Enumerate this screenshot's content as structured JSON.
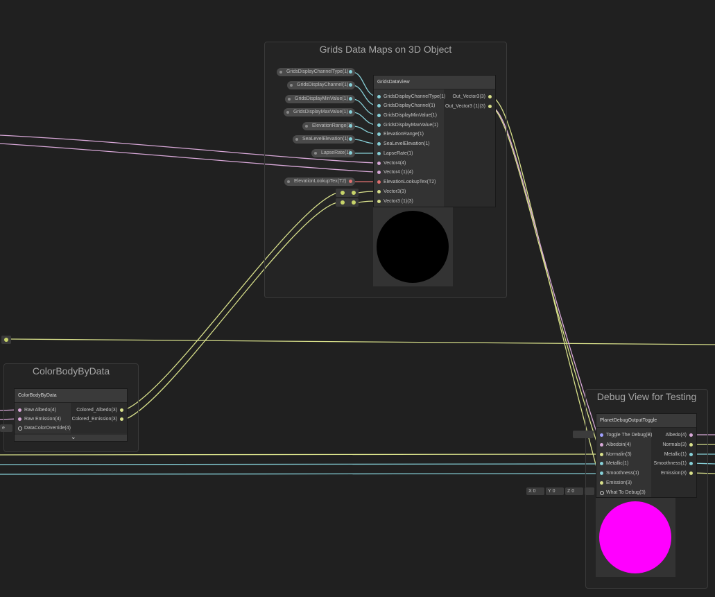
{
  "colors": {
    "background": "#202020",
    "vector4": "#d8a8d8",
    "vector3": "#d8e08a",
    "vector1": "#86d0d8",
    "texture": "#e07070",
    "bool": "#a0a0ff",
    "magenta_preview": "#ff00ff",
    "black_preview": "#000000"
  },
  "groups": {
    "grids": {
      "title": "Grids Data Maps on 3D Object"
    },
    "colorbody": {
      "title": "ColorBodyByData"
    },
    "debug": {
      "title": "Debug View for Testing"
    }
  },
  "grids_node": {
    "title": "GridsDataView",
    "inputs": [
      "GridsDisplayChannelType(1)",
      "GridsDisplayChannel(1)",
      "GridsDisplayMinValue(1)",
      "GridsDisplayMaxValue(1)",
      "ElevationRange(1)",
      "SeaLevelElevation(1)",
      "LapseRate(1)",
      "Vector4(4)",
      "Vector4 (1)(4)",
      "ElevationLookupTex(T2)",
      "Vector3(3)",
      "Vector3 (1)(3)"
    ],
    "outputs": [
      "Out_Vector3(3)",
      "Out_Vector3 (1)(3)"
    ]
  },
  "property_pills": [
    "GridsDisplayChannelType(1)",
    "GridsDisplayChannel(1)",
    "GridsDisplayMinValue(1)",
    "GridsDisplayMaxValue(1)",
    "ElevationRange(1)",
    "SeaLevelElevation(1)",
    "LapseRate(1)",
    "ElevationLookupTex(T2)"
  ],
  "colorbody_node": {
    "title": "ColorBodyByData",
    "inputs": [
      "Raw Albedo(4)",
      "Raw Emission(4)",
      "DataColorOverride(4)"
    ],
    "outputs": [
      "Colored_Albedo(3)",
      "Colored_Emission(3)"
    ],
    "partial_label": "e"
  },
  "debug_node": {
    "title": "PlanetDebugOutputToggle",
    "inputs": [
      "Toggle The Debug(B)",
      "Albedoin(4)",
      "Normalin(3)",
      "Metallic(1)",
      "Smoothness(1)",
      "Emission(3)",
      "What To Debug(3)"
    ],
    "outputs": [
      "Albedo(4)",
      "Normals(3)",
      "Metallic(1)",
      "Smoothness(1)",
      "Emission(3)"
    ],
    "vector_fields": {
      "x_label": "X",
      "x_value": "0",
      "y_label": "Y",
      "y_value": "0",
      "z_label": "Z",
      "z_value": "0"
    }
  }
}
